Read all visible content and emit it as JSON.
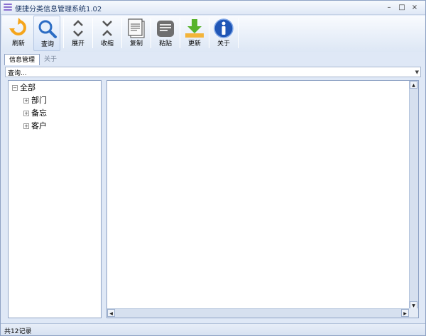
{
  "window": {
    "title": "便捷分类信息管理系统1.02",
    "controls": {
      "minimize": "–",
      "restore": "□",
      "close": "×"
    }
  },
  "toolbar": {
    "buttons": [
      {
        "id": "refresh",
        "label": "刷新",
        "icon": "refresh-icon"
      },
      {
        "id": "query",
        "label": "查询",
        "icon": "search-icon"
      },
      {
        "id": "expand",
        "label": "展开",
        "icon": "expand-icon"
      },
      {
        "id": "collapse",
        "label": "收缩",
        "icon": "collapse-icon"
      },
      {
        "id": "copy",
        "label": "复制",
        "icon": "copy-icon"
      },
      {
        "id": "paste",
        "label": "粘贴",
        "icon": "paste-icon"
      },
      {
        "id": "update",
        "label": "更新",
        "icon": "download-icon"
      },
      {
        "id": "about",
        "label": "关于",
        "icon": "info-icon"
      }
    ]
  },
  "tabs": [
    {
      "label": "信息管理",
      "active": true
    },
    {
      "label": "关于",
      "active": false
    }
  ],
  "search": {
    "value": "查询..."
  },
  "tree": {
    "root": {
      "label": "全部",
      "expander": "⊟"
    },
    "children": [
      {
        "label": "部门",
        "expander": "⊞"
      },
      {
        "label": "备忘",
        "expander": "⊞"
      },
      {
        "label": "客户",
        "expander": "⊞"
      }
    ]
  },
  "status": {
    "text": "共12记录"
  },
  "colors": {
    "accent": "#1f3a66",
    "border": "#8ea2c4",
    "refresh_orange": "#f5a51b",
    "query_blue": "#2b6cc4",
    "update_green": "#58b32d",
    "info_blue": "#1f56b6"
  }
}
